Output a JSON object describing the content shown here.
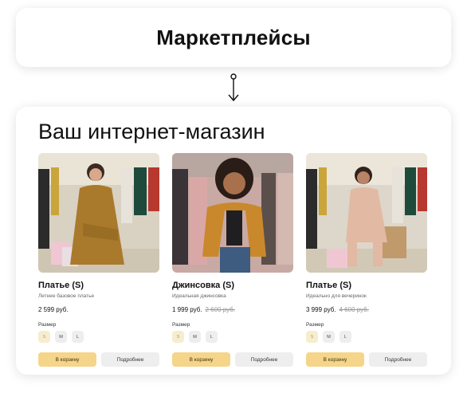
{
  "header": {
    "title": "Маркетплейсы"
  },
  "store": {
    "title": "Ваш интернет-магазин",
    "size_label": "Размер",
    "sizes": [
      "S",
      "M",
      "L"
    ],
    "cart_button": "В корзину",
    "details_button": "Подробнее",
    "products": [
      {
        "name": "Платье (S)",
        "description": "Летнее базовое платье",
        "price": "2 599 руб.",
        "old_price": "",
        "selected_size": "S",
        "image": {
          "icon": "woman-mustard-dress-photo",
          "garment_color": "#a97a2c",
          "bg_color": "#d9d2c3"
        }
      },
      {
        "name": "Джинсовка (S)",
        "description": "Идеальная джинсовка",
        "price": "1 999 руб.",
        "old_price": "2 600 руб.",
        "selected_size": "S",
        "image": {
          "icon": "woman-orange-jacket-photo",
          "garment_color": "#c9882b",
          "bg_color": "#c9a9a4"
        }
      },
      {
        "name": "Платье (S)",
        "description": "Идеально для вечеринок",
        "price": "3 999 руб.",
        "old_price": "4 600 руб.",
        "selected_size": "S",
        "image": {
          "icon": "woman-beige-dress-photo",
          "garment_color": "#e2b9a2",
          "bg_color": "#ddd6ca"
        }
      }
    ]
  }
}
